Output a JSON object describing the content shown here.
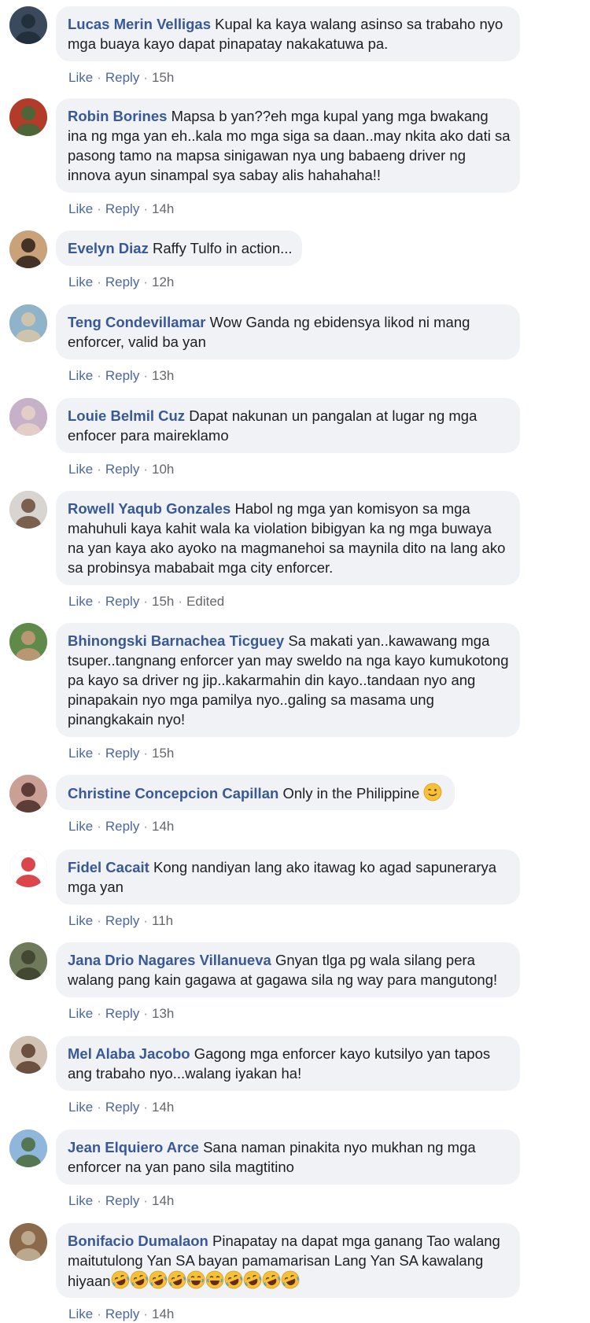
{
  "actions": {
    "like_label": "Like",
    "reply_label": "Reply",
    "separator": "·"
  },
  "comments": [
    {
      "name": "Lucas Merin Velligas",
      "lines": [
        "Kupal ka kaya walang asinso sa trabaho nyo",
        "mga buaya kayo dapat pinapatay nakakatuwa pa."
      ],
      "time": "15h"
    },
    {
      "name": "Robin Borines",
      "lines": [
        "Mapsa b yan??eh mga kupal yang mga bwakang",
        "ina ng mga yan eh..kala mo mga siga sa daan..may nkita ako dati sa",
        "pasong tamo na mapsa sinigawan nya ung babaeng driver ng",
        "innova ayun sinampal sya sabay alis hahahaha!!"
      ],
      "time": "14h"
    },
    {
      "name": "Evelyn Diaz",
      "lines": [
        "Raffy Tulfo in action..."
      ],
      "time": "12h"
    },
    {
      "name": "Teng Condevillamar",
      "lines": [
        "Wow Ganda ng ebidensya likod ni mang",
        "enforcer, valid ba yan"
      ],
      "time": "13h"
    },
    {
      "name": "Louie Belmil Cuz",
      "lines": [
        "Dapat nakunan un pangalan at lugar ng mga",
        "enfocer para maireklamo"
      ],
      "time": "10h"
    },
    {
      "name": "Rowell Yaqub Gonzales",
      "lines": [
        "Habol ng mga yan komisyon sa mga",
        "mahuhuli kaya kahit wala ka violation bibigyan ka ng mga buwaya",
        "na yan kaya ako ayoko na magmanehoi sa maynila dito na lang ako",
        "sa probinsya mababait mga city enforcer."
      ],
      "time": "15h",
      "edited": "Edited"
    },
    {
      "name": "Bhinongski Barnachea Ticguey",
      "lines": [
        "Sa makati yan..kawawang mga",
        "tsuper..tangnang enforcer yan may sweldo na nga kayo kumukotong",
        "pa kayo sa driver ng jip..kakarmahin din kayo..tandaan nyo ang",
        "pinapakain nyo mga pamilya nyo..galing sa masama ung",
        "pinangkakain nyo!"
      ],
      "time": "15h"
    },
    {
      "name": "Christine Concepcion Capillan",
      "lines": [
        "Only in the Philippine"
      ],
      "time": "14h",
      "emoji": "winking-face"
    },
    {
      "name": "Fidel Cacait",
      "lines": [
        "Kong nandiyan lang ako itawag ko agad sapunerarya",
        "mga yan"
      ],
      "time": "11h"
    },
    {
      "name": "Jana Drio Nagares Villanueva",
      "lines": [
        "Gnyan tlga pg wala silang pera",
        "walang pang kain gagawa at gagawa sila ng way para mangutong!"
      ],
      "time": "13h"
    },
    {
      "name": "Mel Alaba Jacobo",
      "lines": [
        "Gagong mga enforcer kayo kutsilyo yan tapos",
        "ang trabaho nyo...walang iyakan ha!"
      ],
      "time": "14h"
    },
    {
      "name": "Jean Elquiero Arce",
      "lines": [
        "Sana naman pinakita nyo mukhan ng mga",
        "enforcer na yan pano sila magtitino"
      ],
      "time": "14h"
    },
    {
      "name": "Bonifacio Dumalaon",
      "lines": [
        "Pinapatay na dapat mga ganang Tao walang",
        "maitutulong Yan SA bayan pamamarisan Lang Yan SA kawalang",
        "hiyaan"
      ],
      "time": "14h",
      "emoji_row": [
        "rofl",
        "rofl",
        "rofl",
        "rofl",
        "joy",
        "joy",
        "rofl",
        "rofl",
        "rofl",
        "rofl"
      ]
    }
  ]
}
